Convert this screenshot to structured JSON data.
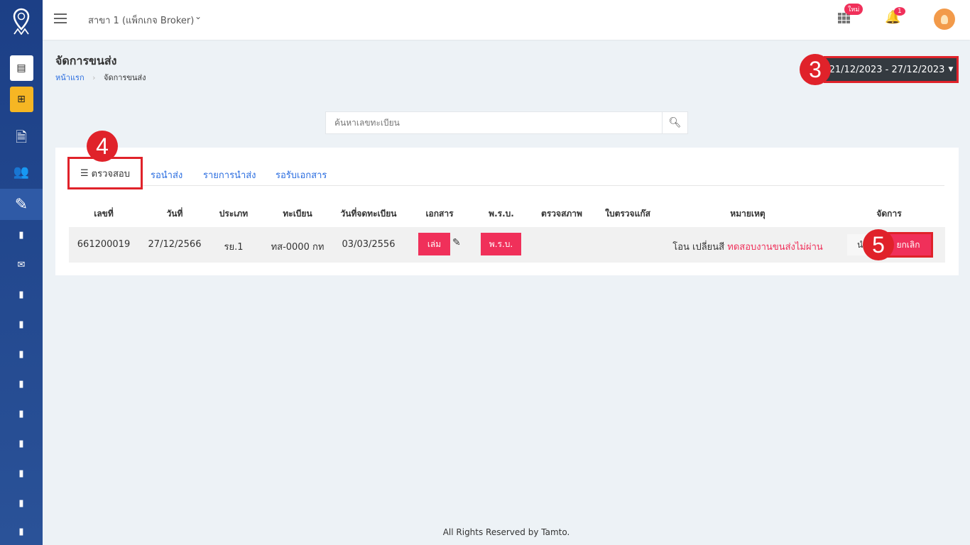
{
  "header": {
    "branch": "สาขา 1 (แพ็กเกจ Broker)",
    "apps_badge": "ใหม่",
    "notif_count": "1"
  },
  "page": {
    "title": "จัดการขนส่ง",
    "breadcrumb": [
      "หน้าแรก",
      "จัดการขนส่ง"
    ],
    "date_range": "21/12/2023 - 27/12/2023"
  },
  "markers": [
    "3",
    "4",
    "5"
  ],
  "search": {
    "placeholder": "ค้นหาเลขทะเบียน"
  },
  "tabs": [
    "ตรวจสอบ",
    "รอนำส่ง",
    "รายการนำส่ง",
    "รอรับเอกสาร"
  ],
  "table": {
    "columns": [
      "เลขที่",
      "วันที่",
      "ประเภท",
      "ทะเบียน",
      "วันที่จดทะเบียน",
      "เอกสาร",
      "พ.ร.บ.",
      "ตรวจสภาพ",
      "ใบตรวจแก๊ส",
      "หมายเหตุ",
      "จัดการ"
    ],
    "rows": [
      {
        "no": "661200019",
        "date": "27/12/2566",
        "type": "รย.1",
        "plate": "ทส-0000 กท",
        "reg_date": "03/03/2556",
        "doc_btn": "เล่ม",
        "prb_btn": "พ.ร.บ.",
        "note_name": "โอน เปลี่ยนสี",
        "note_status": "ทดสอบงานขนส่งไม่ผ่าน",
        "send_btn": "นำส่ง",
        "cancel_btn": "ยกเลิก"
      }
    ]
  },
  "footer": "All Rights Reserved by Tamto.",
  "colors": {
    "sidebar": "#1c3f86",
    "accent": "#f0305a",
    "marker": "#e0222a",
    "link": "#2a6de0"
  }
}
